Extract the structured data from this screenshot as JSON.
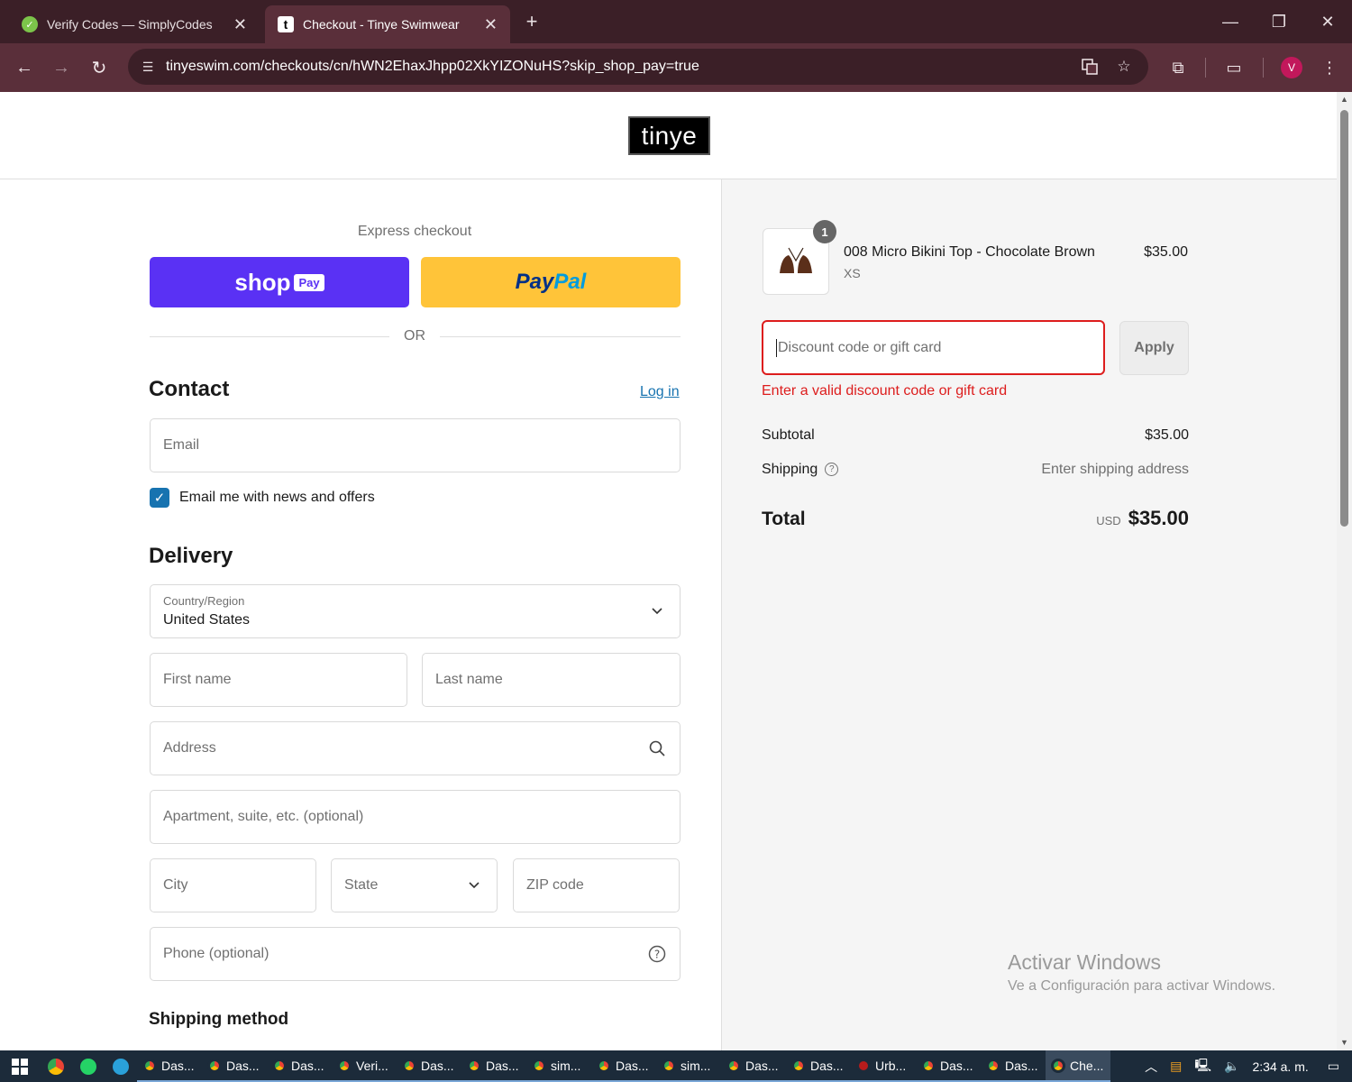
{
  "browser": {
    "tabs": [
      {
        "title": "Verify Codes — SimplyCodes",
        "active": false
      },
      {
        "title": "Checkout - Tinye Swimwear",
        "active": true
      }
    ],
    "url": "tinyeswim.com/checkouts/cn/hWN2EhaxJhpp02XkYIZONuHS?skip_shop_pay=true",
    "profile_initial": "V"
  },
  "store": {
    "logo_text": "tinye"
  },
  "express": {
    "label": "Express checkout",
    "shop_label": "shop",
    "shop_pay_badge": "Pay",
    "paypal_part1": "Pay",
    "paypal_part2": "Pal",
    "or_label": "OR"
  },
  "contact": {
    "heading": "Contact",
    "login_link": "Log in",
    "email_placeholder": "Email",
    "newsletter_label": "Email me with news and offers",
    "newsletter_checked": true
  },
  "delivery": {
    "heading": "Delivery",
    "country_label": "Country/Region",
    "country_value": "United States",
    "first_name_placeholder": "First name",
    "last_name_placeholder": "Last name",
    "address_placeholder": "Address",
    "apartment_placeholder": "Apartment, suite, etc. (optional)",
    "city_placeholder": "City",
    "state_placeholder": "State",
    "zip_placeholder": "ZIP code",
    "phone_placeholder": "Phone (optional)"
  },
  "shipping_method": {
    "heading": "Shipping method"
  },
  "order": {
    "item": {
      "quantity": "1",
      "name": "008 Micro Bikini Top - Chocolate Brown",
      "variant": "XS",
      "price": "$35.00"
    },
    "discount_placeholder": "Discount code or gift card",
    "apply_label": "Apply",
    "discount_error": "Enter a valid discount code or gift card",
    "subtotal_label": "Subtotal",
    "subtotal_value": "$35.00",
    "shipping_label": "Shipping",
    "shipping_value": "Enter shipping address",
    "total_label": "Total",
    "total_currency": "USD",
    "total_value": "$35.00"
  },
  "windows_watermark": {
    "line1": "Activar Windows",
    "line2": "Ve a Configuración para activar Windows."
  },
  "taskbar": {
    "items": [
      "Das...",
      "Das...",
      "Das...",
      "Veri...",
      "Das...",
      "Das...",
      "sim...",
      "Das...",
      "sim...",
      "Das...",
      "Das...",
      "Urb...",
      "Das...",
      "Das...",
      "Che..."
    ],
    "clock": "2:34 a. m."
  },
  "colors": {
    "shop_pay": "#5a31f4",
    "paypal": "#ffc439",
    "error": "#dd1d1d",
    "link": "#1773b0"
  }
}
